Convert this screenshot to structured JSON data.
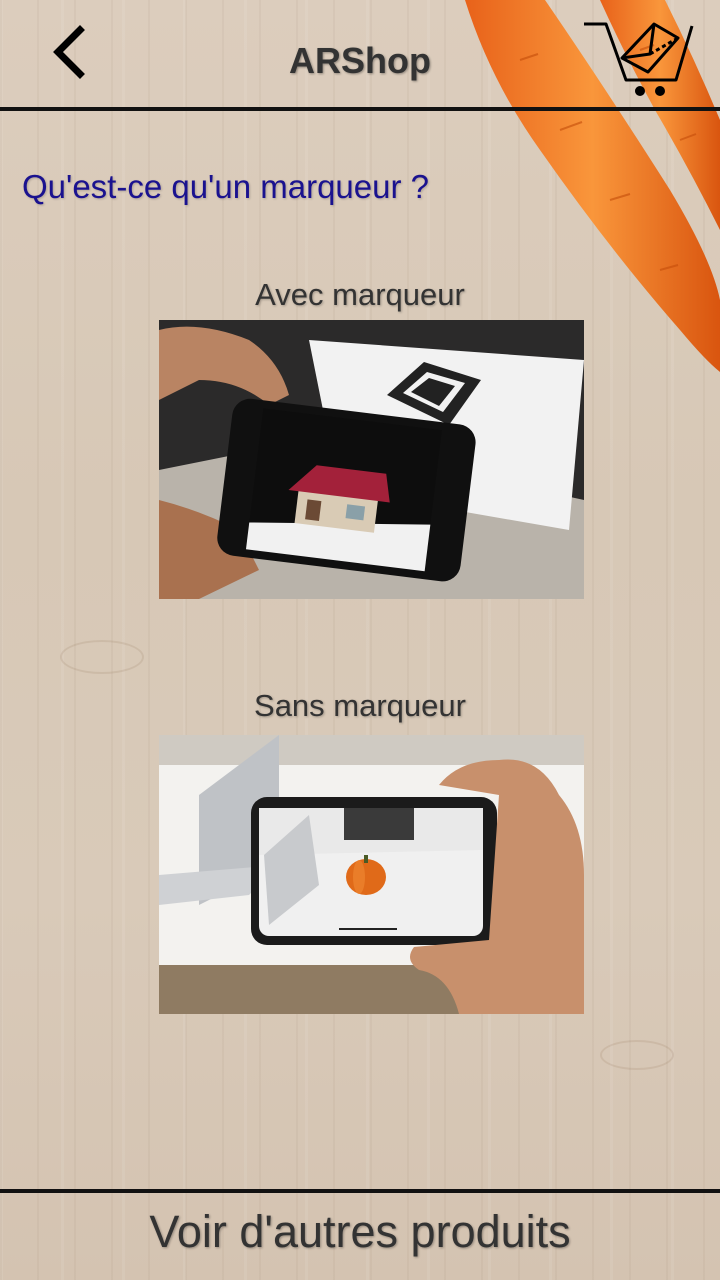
{
  "header": {
    "title": "ARShop"
  },
  "main": {
    "question": "Qu'est-ce qu'un marqueur ?",
    "sections": [
      {
        "caption": "Avec marqueur"
      },
      {
        "caption": "Sans marqueur"
      }
    ]
  },
  "footer": {
    "button_label": "Voir d'autres produits"
  },
  "colors": {
    "question": "#1a128f",
    "text": "#333333",
    "divider": "#111111",
    "carrot": "#f07a22"
  },
  "icons": {
    "back": "chevron-left-icon",
    "cart": "ar-cart-icon"
  }
}
